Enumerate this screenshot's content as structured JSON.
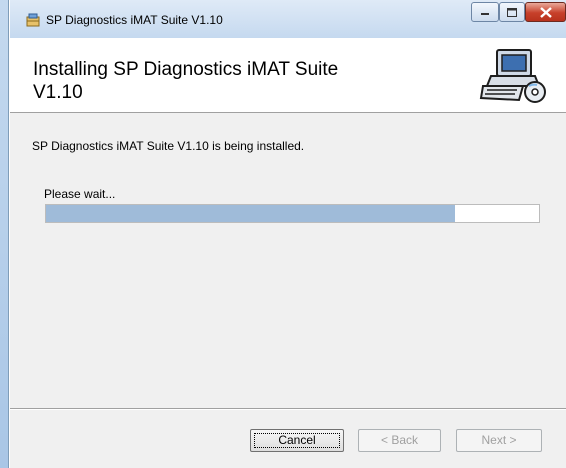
{
  "window": {
    "title": "SP Diagnostics iMAT Suite V1.10",
    "controls": {
      "minimize_icon": "minimize-icon",
      "maximize_icon": "maximize-icon",
      "close_icon": "close-icon"
    }
  },
  "header": {
    "title": "Installing SP Diagnostics iMAT Suite V1.10",
    "icon": "computer-disc-icon"
  },
  "body": {
    "status": "SP Diagnostics iMAT Suite V1.10 is being installed.",
    "wait_label": "Please wait...",
    "progress_fraction": 0.83
  },
  "buttons": {
    "cancel": "Cancel",
    "back": "< Back",
    "next": "Next >"
  },
  "colors": {
    "progress_fill": "#9fbbd9",
    "close_button": "#c7402a"
  }
}
